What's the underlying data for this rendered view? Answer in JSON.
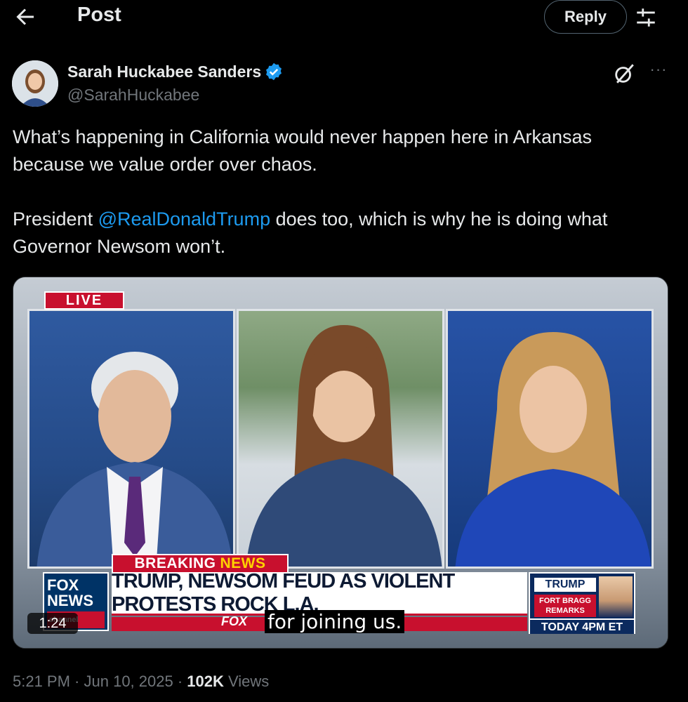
{
  "header": {
    "back_icon": "arrow-left-icon",
    "title": "Post",
    "reply_label": "Reply",
    "tune_icon": "sliders-icon"
  },
  "author": {
    "name": "Sarah Huckabee Sanders",
    "handle": "@SarahHuckabee",
    "verified_icon": "verified-badge-icon",
    "verified_color": "#1d9bf0"
  },
  "post": {
    "line1": "What’s happening in California would never happen here in Arkansas because we value order over chaos.",
    "line2_prefix": "President ",
    "mention": "@RealDonaldTrump",
    "line2_suffix": " does too, which is why he is doing what Governor Newsom won’t."
  },
  "media": {
    "live_label": "LIVE",
    "breaking_label": "BREAKING",
    "news_label": "NEWS",
    "fox_logo_top": "FOX",
    "fox_logo_bottom": "NEWS",
    "fox_logo_channel": "channel",
    "chyron": "TRUMP, NEWSOM FEUD AS VIOLENT PROTESTS ROCK L.A.",
    "fox_small": "FOX",
    "caption": "for joining us.",
    "promo_title": "TRUMP",
    "promo_subtitle": "FORT BRAGG REMARKS",
    "promo_time": "TODAY 4PM ET",
    "duration": "1:24"
  },
  "meta": {
    "time": "5:21 PM",
    "separator": " · ",
    "date": "Jun 10, 2025",
    "views_count": "102K",
    "views_label": " Views"
  },
  "colors": {
    "background": "#000000",
    "text_primary": "#e7e9ea",
    "text_secondary": "#71767b",
    "link": "#1d9bf0",
    "fox_red": "#c8102e"
  }
}
